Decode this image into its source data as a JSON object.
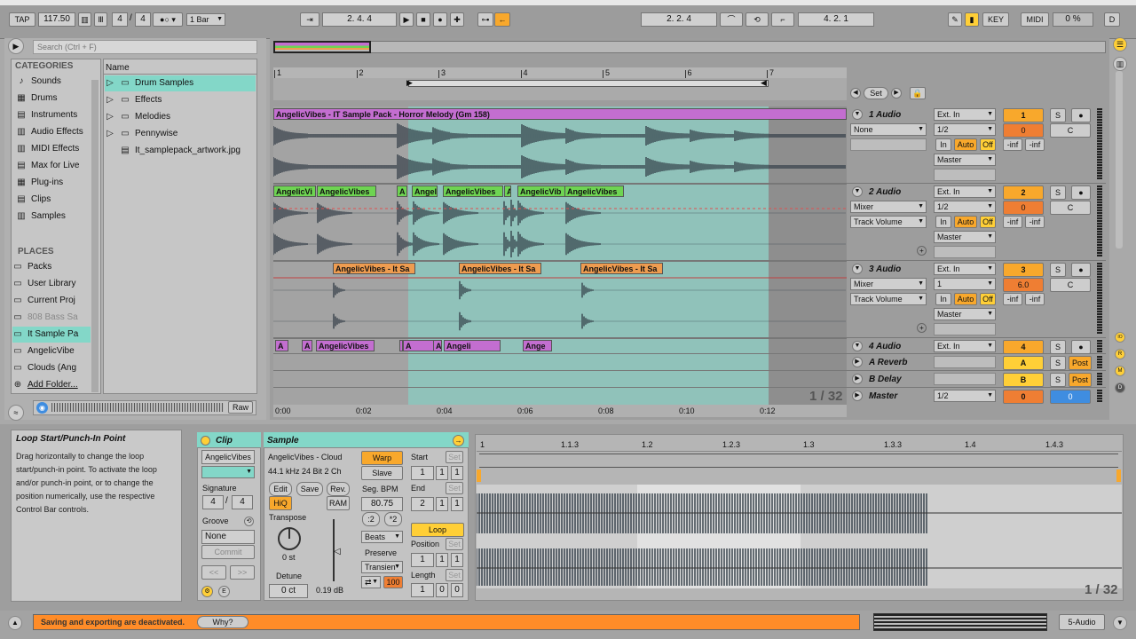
{
  "control_bar": {
    "tap": "TAP",
    "tempo": "117.50",
    "sig_num": "4",
    "sig_den": "4",
    "quant": "1 Bar",
    "arr_pos": "2.   4.   4",
    "loop_start": "2.   2.   4",
    "loop_len": "4.   2.   1",
    "key": "KEY",
    "midi": "MIDI",
    "cpu": "0 %",
    "disk": "D"
  },
  "browser": {
    "search_placeholder": "Search (Ctrl + F)",
    "categories_title": "CATEGORIES",
    "categories": [
      {
        "label": "Sounds",
        "icon": "note-icon"
      },
      {
        "label": "Drums",
        "icon": "drums-icon"
      },
      {
        "label": "Instruments",
        "icon": "instrument-icon"
      },
      {
        "label": "Audio Effects",
        "icon": "audio-effects-icon"
      },
      {
        "label": "MIDI Effects",
        "icon": "midi-effects-icon"
      },
      {
        "label": "Max for Live",
        "icon": "max-icon"
      },
      {
        "label": "Plug-ins",
        "icon": "plugin-icon"
      },
      {
        "label": "Clips",
        "icon": "clips-icon"
      },
      {
        "label": "Samples",
        "icon": "samples-icon"
      }
    ],
    "places_title": "PLACES",
    "places": [
      {
        "label": "Packs"
      },
      {
        "label": "User Library"
      },
      {
        "label": "Current Proj"
      },
      {
        "label": "808 Bass Sa"
      },
      {
        "label": "It Sample Pa"
      },
      {
        "label": "AngelicVibe"
      },
      {
        "label": "Clouds (Ang"
      },
      {
        "label": "Add Folder..."
      }
    ],
    "column_header": "Name",
    "files": [
      {
        "label": "Drum Samples",
        "type": "folder"
      },
      {
        "label": "Effects",
        "type": "folder"
      },
      {
        "label": "Melodies",
        "type": "folder"
      },
      {
        "label": "Pennywise",
        "type": "folder"
      },
      {
        "label": "It_samplepack_artwork.jpg",
        "type": "file"
      }
    ],
    "raw": "Raw"
  },
  "arrangement": {
    "bar_ticks": [
      "1",
      "2",
      "3",
      "4",
      "5",
      "6",
      "7"
    ],
    "time_ticks": [
      "0:00",
      "0:02",
      "0:04",
      "0:06",
      "0:08",
      "0:10",
      "0:12"
    ],
    "zoom": "1 / 32",
    "set_label": "Set",
    "clip_main": "AngelicVibes - IT Sample Pack - Horror Melody (Gm 158)",
    "clips_green": [
      "AngelicVi",
      "AngelicVibes",
      "A",
      "Angel",
      "AngelicVibes",
      "A",
      "AngelicVib",
      "AngelicVibes"
    ],
    "clips_orange": [
      "AngelicVibes - It Sa",
      "AngelicVibes - It Sa",
      "AngelicVibes - It Sa"
    ],
    "clips_pink": [
      "A",
      "A",
      "AngelicVibes",
      "Angeli",
      "A",
      "AngelicVibes",
      "Angeli",
      "Ange"
    ]
  },
  "tracks": [
    {
      "name": "1 Audio",
      "input": "Ext. In",
      "ch": "1/2",
      "num": "1",
      "vol": "0",
      "pan": "C",
      "sub": "None",
      "out": "Master",
      "in_btn": "In",
      "auto": "Auto",
      "off": "Off",
      "inf1": "-inf",
      "inf2": "-inf"
    },
    {
      "name": "2 Audio",
      "input": "Ext. In",
      "ch": "1/2",
      "num": "2",
      "vol": "0",
      "pan": "C",
      "sub": "Mixer",
      "sub2": "Track Volume",
      "out": "Master",
      "in_btn": "In",
      "auto": "Auto",
      "off": "Off",
      "inf1": "-inf",
      "inf2": "-inf"
    },
    {
      "name": "3 Audio",
      "input": "Ext. In",
      "ch": "1",
      "num": "3",
      "vol": "6.0",
      "pan": "C",
      "sub": "Mixer",
      "sub2": "Track Volume",
      "out": "Master",
      "in_btn": "In",
      "auto": "Auto",
      "off": "Off",
      "inf1": "-inf",
      "inf2": "-inf"
    },
    {
      "name": "4 Audio",
      "input": "Ext. In",
      "num": "4"
    },
    {
      "name": "A Reverb",
      "num": "A",
      "post": "Post"
    },
    {
      "name": "B Delay",
      "num": "B",
      "post": "Post"
    },
    {
      "name": "Master",
      "ch": "1/2",
      "num": "0",
      "vol": "0"
    }
  ],
  "info": {
    "title": "Loop Start/Punch-In Point",
    "body": "Drag horizontally to change the loop start/punch-in point. To activate the loop and/or punch-in point, or to change the position numerically, use the respective Control Bar controls."
  },
  "clip_view": {
    "clip_title": "Clip",
    "clip_name": "AngelicVibes",
    "signature": "Signature",
    "sig_num": "4",
    "sig_den": "4",
    "groove": "Groove",
    "groove_val": "None",
    "commit": "Commit",
    "nav_prev": "<<",
    "nav_next": ">>",
    "sample_title": "Sample",
    "sample_name": "AngelicVibes - Cloud",
    "sample_info": "44.1 kHz 24 Bit 2 Ch",
    "edit": "Edit",
    "save": "Save",
    "rev": "Rev.",
    "hiq": "HiQ",
    "ram": "RAM",
    "transpose": "Transpose",
    "transpose_val": "0 st",
    "detune": "Detune",
    "detune_val": "0 ct",
    "gain": "0.19 dB",
    "warp": "Warp",
    "slave": "Slave",
    "seg_bpm": "Seg. BPM",
    "bpm_val": "80.75",
    "half": ":2",
    "double": "*2",
    "beats": "Beats",
    "preserve": "Preserve",
    "transient": "Transien",
    "fade": "100",
    "start": "Start",
    "start_vals": [
      "1",
      "1",
      "1"
    ],
    "end": "End",
    "end_vals": [
      "2",
      "1",
      "1"
    ],
    "loop": "Loop",
    "position": "Position",
    "pos_vals": [
      "1",
      "1",
      "1"
    ],
    "length": "Length",
    "len_vals": [
      "1",
      "0",
      "0"
    ],
    "set": "Set",
    "sample_ticks": [
      "1",
      "1.1.3",
      "1.2",
      "1.2.3",
      "1.3",
      "1.3.3",
      "1.4",
      "1.4.3"
    ],
    "zoom": "1 / 32"
  },
  "status": {
    "message": "Saving and exporting are deactivated.",
    "why": "Why?",
    "track": "5-Audio"
  }
}
